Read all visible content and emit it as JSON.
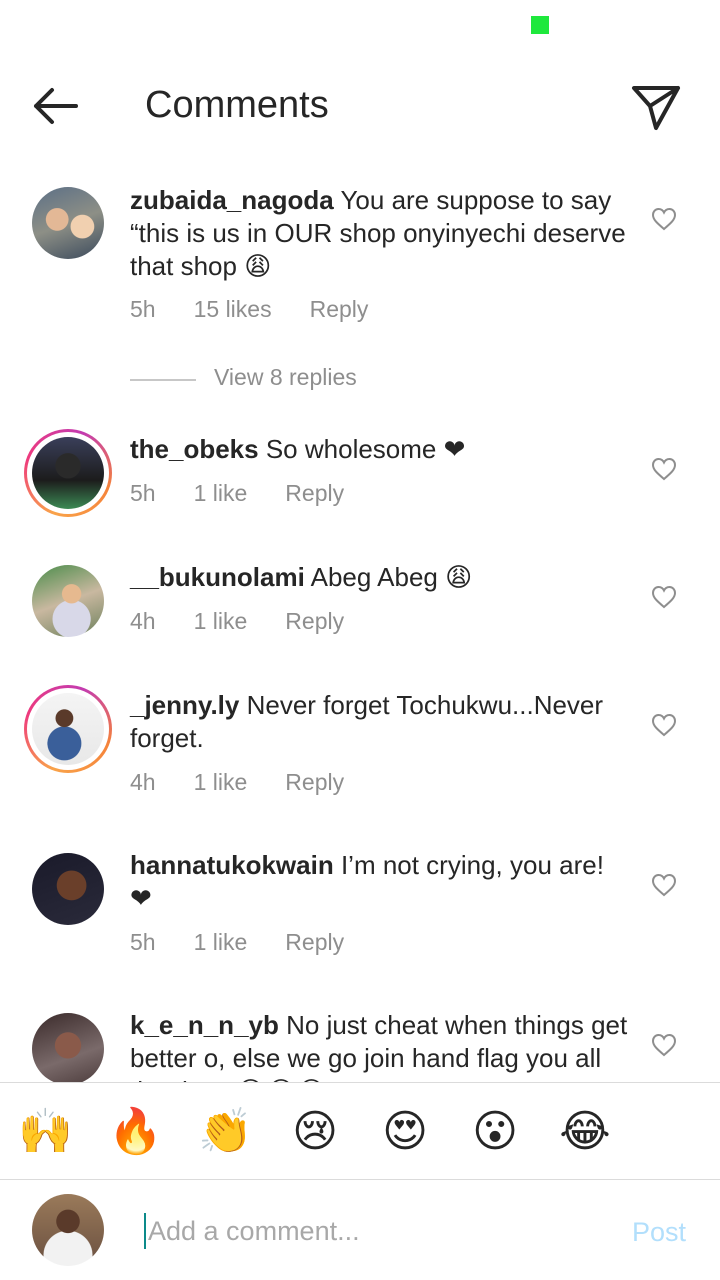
{
  "header": {
    "title": "Comments"
  },
  "view_replies_label": "View 8 replies",
  "comments": [
    {
      "user": "zubaida_nagoda",
      "text": "You are suppose to say “this is us in OUR shop onyinyechi deserve that shop 😩",
      "time": "5h",
      "likes": "15 likes",
      "reply": "Reply"
    },
    {
      "user": "the_obeks",
      "text": "So wholesome ❤",
      "time": "5h",
      "likes": "1 like",
      "reply": "Reply"
    },
    {
      "user": "__bukunolami",
      "text": "Abeg Abeg 😩",
      "time": "4h",
      "likes": "1 like",
      "reply": "Reply"
    },
    {
      "user": "_jenny.ly",
      "text": "Never forget Tochukwu...Never forget.",
      "time": "4h",
      "likes": "1 like",
      "reply": "Reply"
    },
    {
      "user": "hannatukokwain",
      "text": "I’m not crying, you are! ❤",
      "time": "5h",
      "likes": "1 like",
      "reply": "Reply"
    },
    {
      "user": "k_e_n_n_yb",
      "text": "No just cheat when things get better o, else we go join hand flag you all the days 😂😂😂",
      "time": "",
      "likes": "",
      "reply": ""
    }
  ],
  "emoji_bar": [
    "🙌",
    "🔥",
    "👏",
    "😢",
    "😍",
    "😮",
    "😂"
  ],
  "compose": {
    "placeholder": "Add a comment...",
    "post_label": "Post"
  },
  "colors": {
    "link_disabled": "#b2dffc",
    "meta_text": "#8e8e8e",
    "status_dot": "#1ee83c"
  }
}
